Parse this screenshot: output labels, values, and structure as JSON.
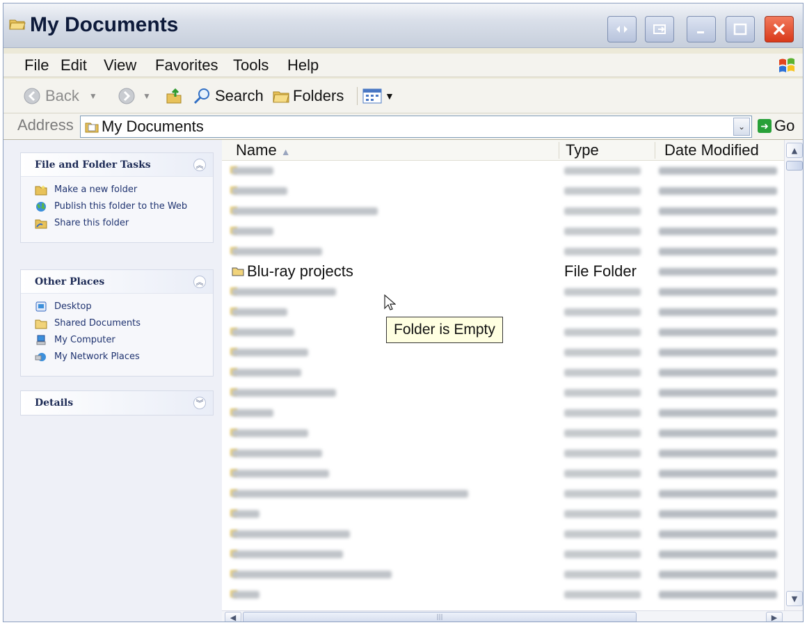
{
  "window": {
    "title": "My Documents",
    "title_icon": "folder-open-icon",
    "buttons": [
      "resize-icon",
      "restore-icon",
      "minimize-icon",
      "maximize-icon",
      "close-icon"
    ]
  },
  "menu": [
    "File",
    "Edit",
    "View",
    "Favorites",
    "Tools",
    "Help"
  ],
  "toolbar": {
    "back": "Back",
    "search": "Search",
    "folders": "Folders"
  },
  "address": {
    "label": "Address",
    "value": "My Documents",
    "go": "Go"
  },
  "tasks": {
    "file_folder": {
      "title": "File and Folder Tasks",
      "items": [
        "Make a new folder",
        "Publish this folder to the Web",
        "Share this folder"
      ]
    },
    "other_places": {
      "title": "Other Places",
      "items": [
        "Desktop",
        "Shared Documents",
        "My Computer",
        "My Network Places"
      ]
    },
    "details": {
      "title": "Details"
    }
  },
  "columns": {
    "name": "Name",
    "type": "Type",
    "date": "Date Modified"
  },
  "selected_row": {
    "name": "Blu-ray projects",
    "type": "File Folder"
  },
  "tooltip": "Folder is Empty",
  "colors": {
    "titlebar": "#d9dfe9",
    "close": "#d9391a",
    "tooltip_bg": "#ffffe1",
    "link": "#1f3370"
  }
}
